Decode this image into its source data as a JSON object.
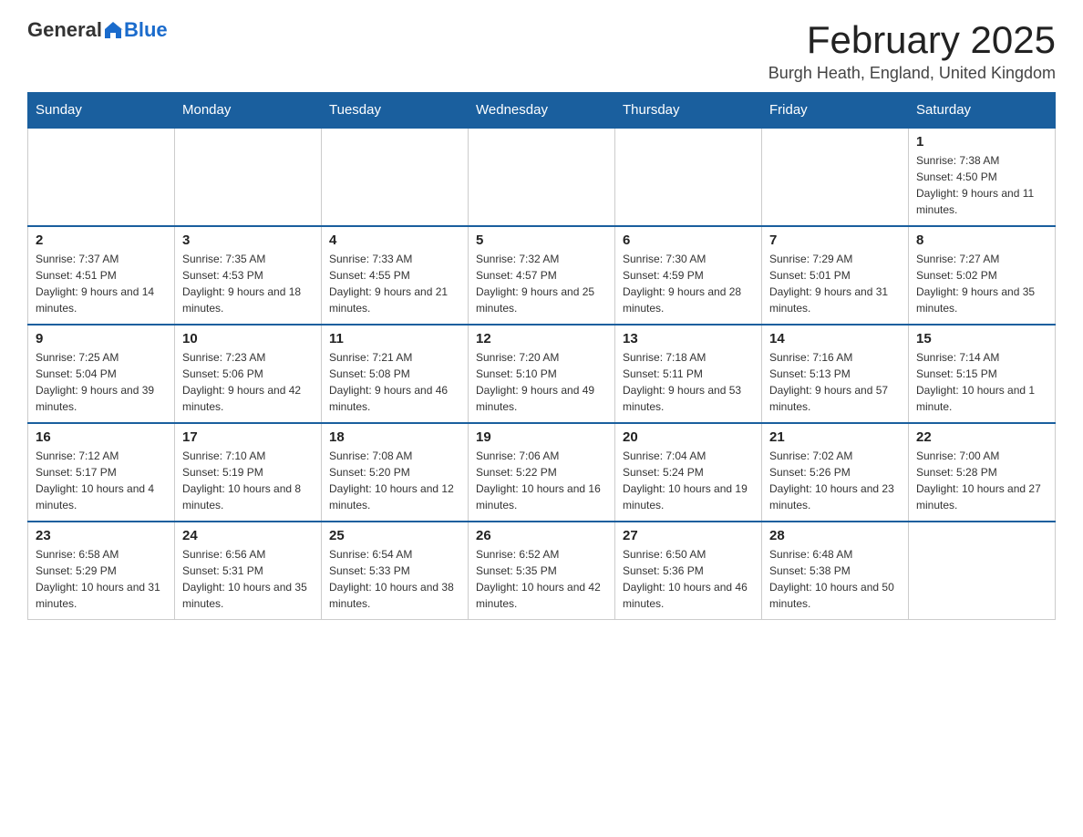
{
  "header": {
    "logo_general": "General",
    "logo_blue": "Blue",
    "title": "February 2025",
    "subtitle": "Burgh Heath, England, United Kingdom"
  },
  "days_of_week": [
    "Sunday",
    "Monday",
    "Tuesday",
    "Wednesday",
    "Thursday",
    "Friday",
    "Saturday"
  ],
  "weeks": [
    [
      {
        "day": "",
        "info": ""
      },
      {
        "day": "",
        "info": ""
      },
      {
        "day": "",
        "info": ""
      },
      {
        "day": "",
        "info": ""
      },
      {
        "day": "",
        "info": ""
      },
      {
        "day": "",
        "info": ""
      },
      {
        "day": "1",
        "info": "Sunrise: 7:38 AM\nSunset: 4:50 PM\nDaylight: 9 hours and 11 minutes."
      }
    ],
    [
      {
        "day": "2",
        "info": "Sunrise: 7:37 AM\nSunset: 4:51 PM\nDaylight: 9 hours and 14 minutes."
      },
      {
        "day": "3",
        "info": "Sunrise: 7:35 AM\nSunset: 4:53 PM\nDaylight: 9 hours and 18 minutes."
      },
      {
        "day": "4",
        "info": "Sunrise: 7:33 AM\nSunset: 4:55 PM\nDaylight: 9 hours and 21 minutes."
      },
      {
        "day": "5",
        "info": "Sunrise: 7:32 AM\nSunset: 4:57 PM\nDaylight: 9 hours and 25 minutes."
      },
      {
        "day": "6",
        "info": "Sunrise: 7:30 AM\nSunset: 4:59 PM\nDaylight: 9 hours and 28 minutes."
      },
      {
        "day": "7",
        "info": "Sunrise: 7:29 AM\nSunset: 5:01 PM\nDaylight: 9 hours and 31 minutes."
      },
      {
        "day": "8",
        "info": "Sunrise: 7:27 AM\nSunset: 5:02 PM\nDaylight: 9 hours and 35 minutes."
      }
    ],
    [
      {
        "day": "9",
        "info": "Sunrise: 7:25 AM\nSunset: 5:04 PM\nDaylight: 9 hours and 39 minutes."
      },
      {
        "day": "10",
        "info": "Sunrise: 7:23 AM\nSunset: 5:06 PM\nDaylight: 9 hours and 42 minutes."
      },
      {
        "day": "11",
        "info": "Sunrise: 7:21 AM\nSunset: 5:08 PM\nDaylight: 9 hours and 46 minutes."
      },
      {
        "day": "12",
        "info": "Sunrise: 7:20 AM\nSunset: 5:10 PM\nDaylight: 9 hours and 49 minutes."
      },
      {
        "day": "13",
        "info": "Sunrise: 7:18 AM\nSunset: 5:11 PM\nDaylight: 9 hours and 53 minutes."
      },
      {
        "day": "14",
        "info": "Sunrise: 7:16 AM\nSunset: 5:13 PM\nDaylight: 9 hours and 57 minutes."
      },
      {
        "day": "15",
        "info": "Sunrise: 7:14 AM\nSunset: 5:15 PM\nDaylight: 10 hours and 1 minute."
      }
    ],
    [
      {
        "day": "16",
        "info": "Sunrise: 7:12 AM\nSunset: 5:17 PM\nDaylight: 10 hours and 4 minutes."
      },
      {
        "day": "17",
        "info": "Sunrise: 7:10 AM\nSunset: 5:19 PM\nDaylight: 10 hours and 8 minutes."
      },
      {
        "day": "18",
        "info": "Sunrise: 7:08 AM\nSunset: 5:20 PM\nDaylight: 10 hours and 12 minutes."
      },
      {
        "day": "19",
        "info": "Sunrise: 7:06 AM\nSunset: 5:22 PM\nDaylight: 10 hours and 16 minutes."
      },
      {
        "day": "20",
        "info": "Sunrise: 7:04 AM\nSunset: 5:24 PM\nDaylight: 10 hours and 19 minutes."
      },
      {
        "day": "21",
        "info": "Sunrise: 7:02 AM\nSunset: 5:26 PM\nDaylight: 10 hours and 23 minutes."
      },
      {
        "day": "22",
        "info": "Sunrise: 7:00 AM\nSunset: 5:28 PM\nDaylight: 10 hours and 27 minutes."
      }
    ],
    [
      {
        "day": "23",
        "info": "Sunrise: 6:58 AM\nSunset: 5:29 PM\nDaylight: 10 hours and 31 minutes."
      },
      {
        "day": "24",
        "info": "Sunrise: 6:56 AM\nSunset: 5:31 PM\nDaylight: 10 hours and 35 minutes."
      },
      {
        "day": "25",
        "info": "Sunrise: 6:54 AM\nSunset: 5:33 PM\nDaylight: 10 hours and 38 minutes."
      },
      {
        "day": "26",
        "info": "Sunrise: 6:52 AM\nSunset: 5:35 PM\nDaylight: 10 hours and 42 minutes."
      },
      {
        "day": "27",
        "info": "Sunrise: 6:50 AM\nSunset: 5:36 PM\nDaylight: 10 hours and 46 minutes."
      },
      {
        "day": "28",
        "info": "Sunrise: 6:48 AM\nSunset: 5:38 PM\nDaylight: 10 hours and 50 minutes."
      },
      {
        "day": "",
        "info": ""
      }
    ]
  ]
}
